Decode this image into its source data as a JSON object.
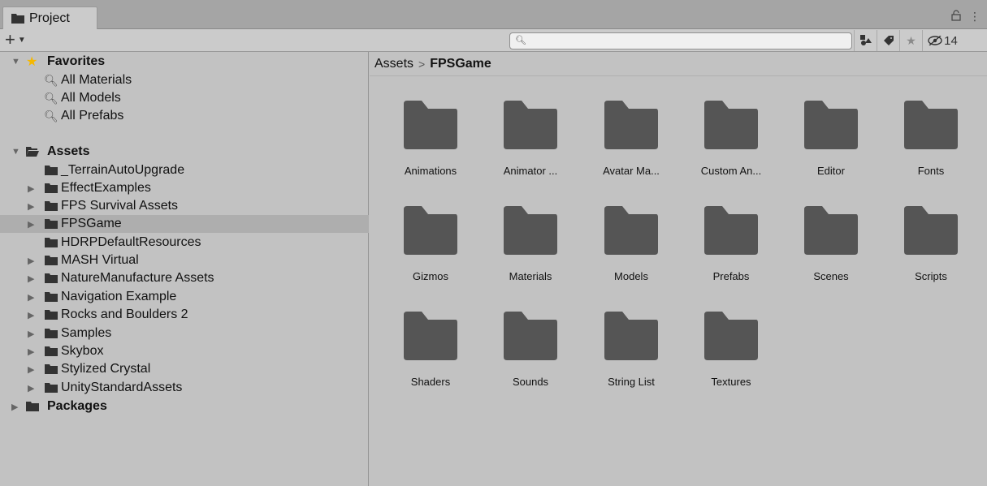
{
  "window": {
    "tab_title": "Project",
    "lock_icon": "lock-icon",
    "menu_icon": "kebab-menu-icon"
  },
  "toolbar": {
    "add_label": "+",
    "search_placeholder": "",
    "hidden_count": "14"
  },
  "tree": {
    "favorites_label": "Favorites",
    "favorites": [
      "All Materials",
      "All Models",
      "All Prefabs"
    ],
    "assets_label": "Assets",
    "assets_items": [
      {
        "label": "_TerrainAutoUpgrade",
        "expandable": false
      },
      {
        "label": "EffectExamples",
        "expandable": true
      },
      {
        "label": "FPS Survival Assets",
        "expandable": true
      },
      {
        "label": "FPSGame",
        "expandable": true,
        "selected": true
      },
      {
        "label": "HDRPDefaultResources",
        "expandable": false
      },
      {
        "label": "MASH Virtual",
        "expandable": true
      },
      {
        "label": "NatureManufacture Assets",
        "expandable": true
      },
      {
        "label": "Navigation Example",
        "expandable": true
      },
      {
        "label": "Rocks and Boulders 2",
        "expandable": true
      },
      {
        "label": "Samples",
        "expandable": true
      },
      {
        "label": "Skybox",
        "expandable": true
      },
      {
        "label": "Stylized Crystal",
        "expandable": true
      },
      {
        "label": "UnityStandardAssets",
        "expandable": true
      }
    ],
    "packages_label": "Packages"
  },
  "breadcrumb": {
    "root": "Assets",
    "separator": ">",
    "current": "FPSGame"
  },
  "folders": [
    "Animations",
    "Animator ...",
    "Avatar Ma...",
    "Custom An...",
    "Editor",
    "Fonts",
    "Gizmos",
    "Materials",
    "Models",
    "Prefabs",
    "Scenes",
    "Scripts",
    "Shaders",
    "Sounds",
    "String List",
    "Textures"
  ],
  "colors": {
    "folder": "#555555",
    "star": "#f5b800",
    "panel": "#c2c2c2",
    "selected_row": "#aeaeae"
  }
}
